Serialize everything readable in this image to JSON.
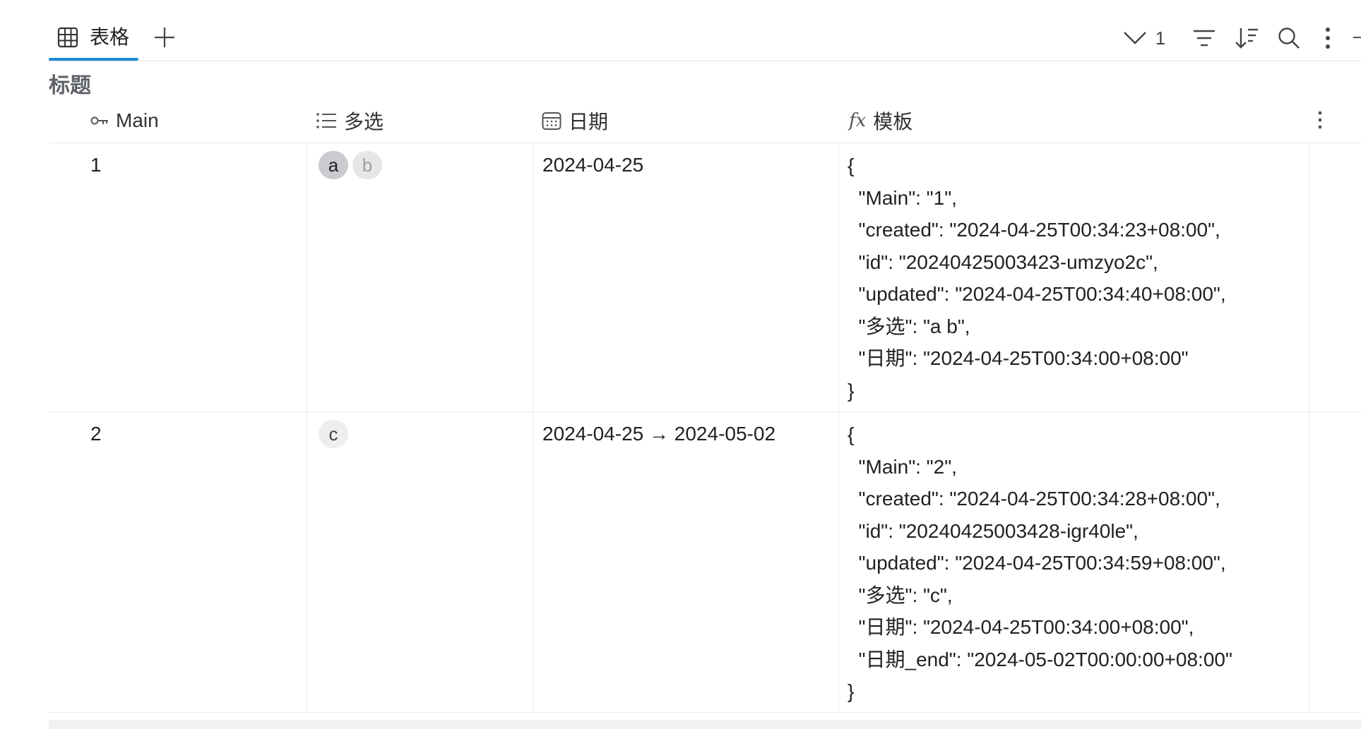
{
  "tabs": {
    "view_label": "表格",
    "add_tab_icon": "plus-icon"
  },
  "toolbar": {
    "filter_count": "1",
    "icons": [
      "chevron-down-icon",
      "filter-icon",
      "sort-icon",
      "search-icon",
      "more-vertical-icon"
    ]
  },
  "title": "标题",
  "columns": [
    {
      "icon": "key-icon",
      "label": "Main"
    },
    {
      "icon": "list-icon",
      "label": "多选"
    },
    {
      "icon": "calendar-icon",
      "label": "日期"
    },
    {
      "icon": "formula-icon",
      "label": "模板"
    }
  ],
  "rows": [
    {
      "main": "1",
      "tags": [
        {
          "label": "a",
          "bg": "#c9cbcf",
          "color": "#202124"
        },
        {
          "label": "b",
          "bg": "#e6e6e6",
          "color": "#9aa0a6"
        }
      ],
      "date": "2024-04-25",
      "template": [
        "{",
        "  \"Main\": \"1\",",
        "  \"created\": \"2024-04-25T00:34:23+08:00\",",
        "  \"id\": \"20240425003423-umzyo2c\",",
        "  \"updated\": \"2024-04-25T00:34:40+08:00\",",
        "  \"多选\": \"a b\",",
        "  \"日期\": \"2024-04-25T00:34:00+08:00\"",
        "}"
      ]
    },
    {
      "main": "2",
      "tags": [
        {
          "label": "c",
          "bg": "#eeeeee",
          "color": "#444444"
        }
      ],
      "date": "2024-04-25 → 2024-05-02",
      "template": [
        "{",
        "  \"Main\": \"2\",",
        "  \"created\": \"2024-04-25T00:34:28+08:00\",",
        "  \"id\": \"20240425003428-igr40le\",",
        "  \"updated\": \"2024-04-25T00:34:59+08:00\",",
        "  \"多选\": \"c\",",
        "  \"日期\": \"2024-04-25T00:34:00+08:00\",",
        "  \"日期_end\": \"2024-05-02T00:00:00+08:00\"",
        "}"
      ]
    }
  ],
  "colors": {
    "accent": "#1a8bd6",
    "border": "#e8e8e8"
  }
}
